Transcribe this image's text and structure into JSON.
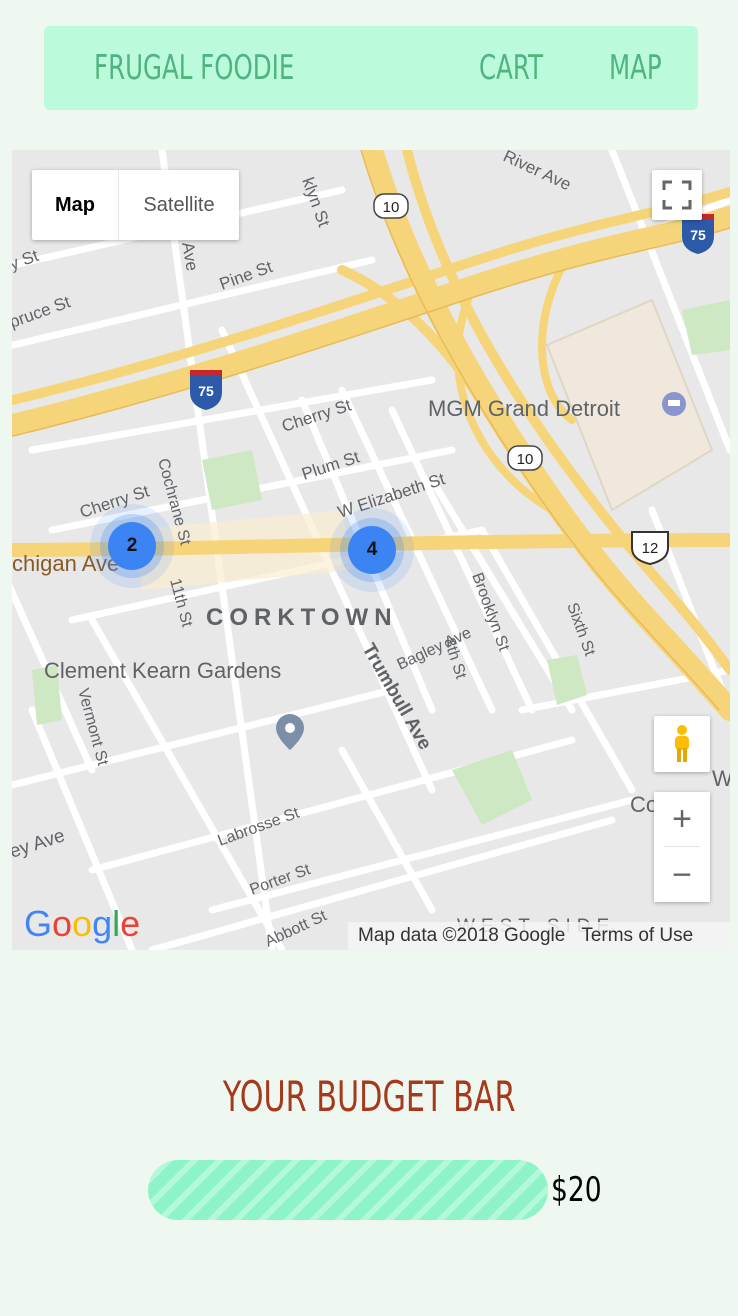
{
  "nav": {
    "brand": "FRUGAL FOODIE",
    "cart": "CART",
    "map": "MAP"
  },
  "map": {
    "type_map": "Map",
    "type_satellite": "Satellite",
    "attribution": "Map data ©2018 Google",
    "terms": "Terms of Use",
    "logo": "Google",
    "zoom_in": "+",
    "zoom_out": "−",
    "clusters": [
      {
        "count": "2"
      },
      {
        "count": "4"
      }
    ],
    "labels": {
      "neighborhood": "CORKTOWN",
      "west_side": "WEST SIDE",
      "mgm": "MGM Grand Detroit",
      "gardens": "Clement Kearn Gardens",
      "michigan": "chigan Ave",
      "trumbull": "Trumbull Ave",
      "brooklyn": "Brooklyn St",
      "sixth": "Sixth St",
      "eighth": "8th St",
      "bagley": "Bagley Ave",
      "labrosse": "Labrosse St",
      "porter": "Porter St",
      "abbott": "Abbott St",
      "vermont": "Vermont St",
      "cochrane": "Cochrane St",
      "eleventh": "11th St",
      "cherry1": "Cherry St",
      "cherry2": "Cherry St",
      "plum": "Plum St",
      "welizabeth": "W Elizabeth St",
      "pine": "Pine St",
      "spruce": "pruce St",
      "river": "River Ave",
      "klyn": "klyn St",
      "ll_ave": "ll Ave",
      "ey_ave": "ey Ave",
      "y_st": "y St",
      "w_right": "W",
      "co_right": "Co",
      "shield_10a": "10",
      "shield_10b": "10",
      "shield_75a": "75",
      "shield_75b": "75",
      "shield_12": "12"
    }
  },
  "budget": {
    "title": "YOUR BUDGET BAR",
    "amount": "$20"
  },
  "colors": {
    "nav_bg": "#bbfadb",
    "nav_text": "#4fb47f",
    "budget_title": "#a6391c",
    "budget_bar": "#8ef4c7",
    "cluster": "#3c84f4"
  }
}
